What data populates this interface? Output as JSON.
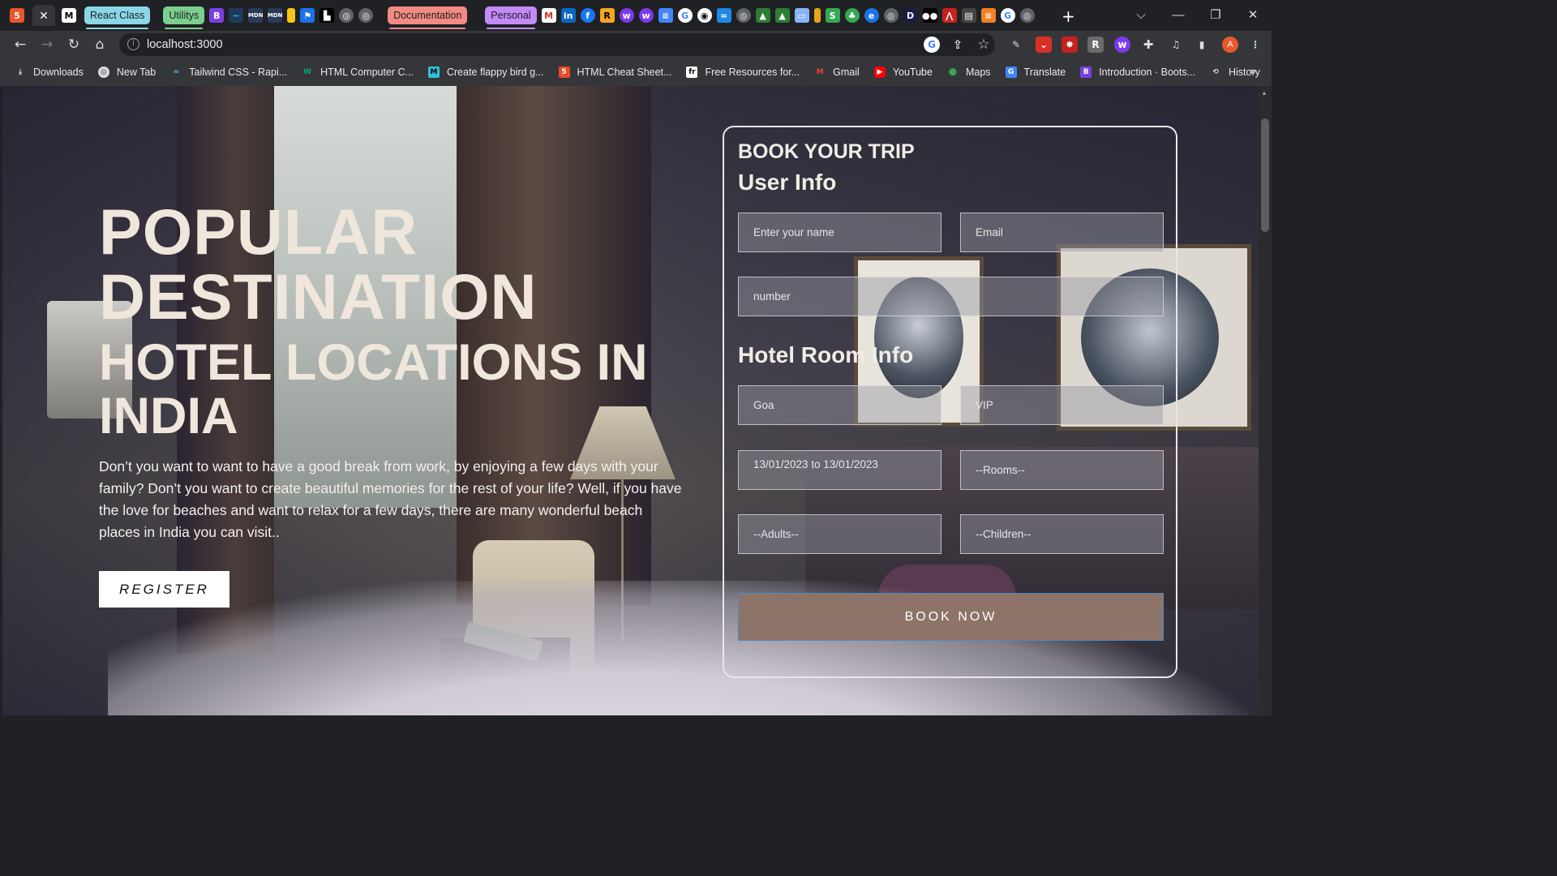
{
  "browser": {
    "tabs": {
      "groups": [
        {
          "label": "React Class",
          "color": "#8ad7e8"
        },
        {
          "label": "Utilitys",
          "color": "#7ccf8e"
        },
        {
          "label": "Documentation",
          "color": "#f28b82"
        },
        {
          "label": "Personal",
          "color": "#c58af9"
        }
      ],
      "active_close": "✕"
    },
    "url": "localhost:3000",
    "avatar_letter": "A",
    "bookmarks": [
      {
        "label": "Downloads",
        "icon": "download-icon"
      },
      {
        "label": "New Tab",
        "icon": "globe-icon"
      },
      {
        "label": "Tailwind CSS - Rapi...",
        "icon": "tailwind-icon"
      },
      {
        "label": "HTML Computer C...",
        "icon": "w3-icon"
      },
      {
        "label": "Create flappy bird g...",
        "icon": "m-icon"
      },
      {
        "label": "HTML Cheat Sheet...",
        "icon": "html-icon"
      },
      {
        "label": "Free Resources for...",
        "icon": "fr-icon"
      },
      {
        "label": "Gmail",
        "icon": "gmail-icon"
      },
      {
        "label": "YouTube",
        "icon": "youtube-icon"
      },
      {
        "label": "Maps",
        "icon": "maps-icon"
      },
      {
        "label": "Translate",
        "icon": "translate-icon"
      },
      {
        "label": "Introduction · Boots...",
        "icon": "bootstrap-icon"
      },
      {
        "label": "History",
        "icon": "history-icon"
      }
    ]
  },
  "hero": {
    "title_line1": "POPULAR",
    "title_line2": "DESTINATION",
    "subtitle": "HOTEL LOCATIONS IN INDIA",
    "description": "Don’t you want to want to have a good break from work, by enjoying a few days with your family? Don’t you want to create beautiful memories for the rest of your life? Well, if you have the love for beaches and want to relax for a few days, there are many wonderful beach places in India you can visit..",
    "register_label": "REGISTER"
  },
  "booking": {
    "title": "BOOK YOUR TRIP",
    "user_info_heading": "User Info",
    "name_placeholder": "Enter your name",
    "email_placeholder": "Email",
    "number_placeholder": "number",
    "room_info_heading": "Hotel Room Info",
    "location_value": "Goa",
    "room_type_value": "VIP",
    "date_range_value": "13/01/2023 to 13/01/2023",
    "rooms_value": "--Rooms--",
    "adults_value": "--Adults--",
    "children_value": "--Children--",
    "book_label": "BOOK NOW"
  }
}
